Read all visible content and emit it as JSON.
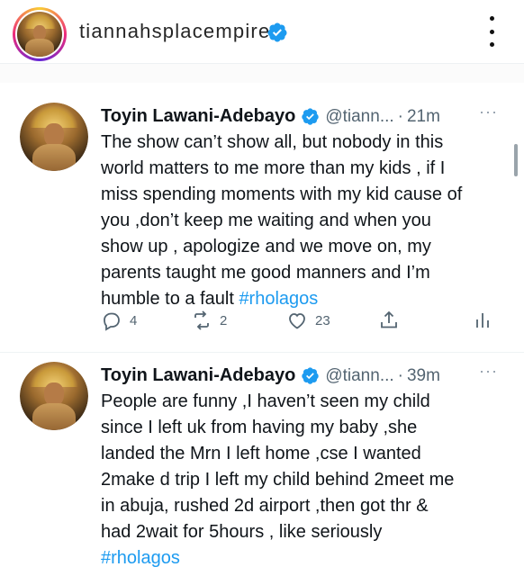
{
  "ig": {
    "username": "tiannahsplacempire",
    "verified": true,
    "more_icon": "vertical-ellipsis-icon"
  },
  "tweets": [
    {
      "name": "Toyin Lawani-Adebayo",
      "handle": "@tiann...",
      "sep": "·",
      "time": "21m",
      "more": "···",
      "lines": [
        "The show can’t show all, but nobody in this",
        "world matters to me more than my kids , if I",
        "miss spending moments with my kid cause of",
        "you ,don’t keep me waiting and when you",
        "show up , apologize and we move on, my",
        "parents taught me good manners and I’m"
      ],
      "last_line_text": "humble to a fault ",
      "hashtag": "#rholagos",
      "replies": "4",
      "retweets": "2",
      "likes": "23"
    },
    {
      "name": "Toyin Lawani-Adebayo",
      "handle": "@tiann...",
      "sep": "·",
      "time": "39m",
      "more": "···",
      "lines": [
        "People are funny ,I haven’t seen my child",
        "since I left uk from having my baby ,she",
        "landed the Mrn I left home ,cse I wanted",
        "2make d trip I left my child behind 2meet me",
        "in abuja, rushed 2d airport ,then got thr &",
        "had 2wait for 5hours , like seriously"
      ],
      "hashtag": "#rholagos"
    }
  ],
  "colors": {
    "link": "#1d9bf0",
    "verified": "#1d9bf0",
    "secondary_text": "#536471"
  }
}
